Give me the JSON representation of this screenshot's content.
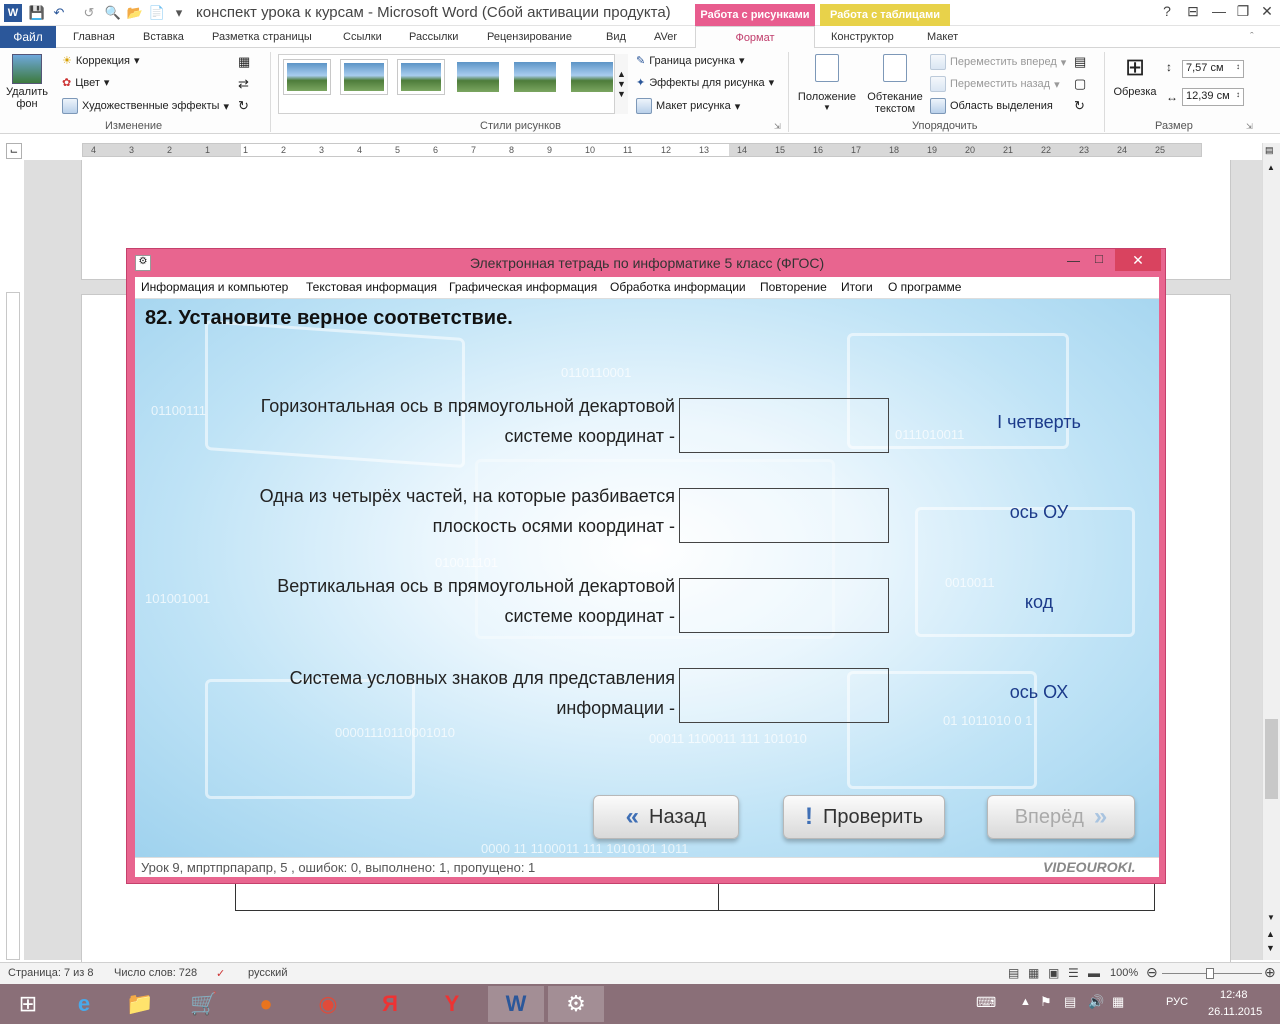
{
  "word": {
    "title": "конспект урока к курсам  -  Microsoft Word (Сбой активации продукта)",
    "context_tabs": [
      "Работа с рисунками",
      "Работа с таблицами"
    ],
    "tabs": [
      "Файл",
      "Главная",
      "Вставка",
      "Разметка страницы",
      "Ссылки",
      "Рассылки",
      "Рецензирование",
      "Вид",
      "AVer",
      "Формат",
      "Конструктор",
      "Макет"
    ],
    "ribbon": {
      "remove_bg": "Удалить фон",
      "correction": "Коррекция",
      "color": "Цвет",
      "artistic": "Художественные эффекты",
      "group_change": "Изменение",
      "group_styles": "Стили рисунков",
      "border": "Граница рисунка",
      "effects": "Эффекты для рисунка",
      "layout": "Макет рисунка",
      "position": "Положение",
      "wrap": "Обтекание текстом",
      "bring_forward": "Переместить вперед",
      "send_backward": "Переместить назад",
      "selection_pane": "Область выделения",
      "group_arrange": "Упорядочить",
      "crop": "Обрезка",
      "height": "7,57 см",
      "width": "12,39 см",
      "group_size": "Размер"
    },
    "ruler_marks": [
      "4",
      "3",
      "2",
      "1",
      "1",
      "2",
      "3",
      "4",
      "5",
      "6",
      "7",
      "8",
      "9",
      "10",
      "11",
      "12",
      "13",
      "14",
      "15",
      "16",
      "17",
      "18",
      "19",
      "20",
      "21",
      "22",
      "23",
      "24",
      "25"
    ],
    "status": {
      "page": "Страница: 7 из 8",
      "words": "Число слов: 728",
      "lang": "русский",
      "zoom": "100%"
    }
  },
  "app": {
    "title": "Электронная тетрадь по информатике 5 класс (ФГОС)",
    "menu": [
      "Информация и компьютер",
      "Текстовая информация",
      "Графическая информация",
      "Обработка информации",
      "Повторение",
      "Итоги",
      "О программе"
    ],
    "question": "82. Установите верное соответствие.",
    "items": [
      {
        "line1": "Горизонтальная ось в прямоугольной декартовой",
        "line2": "системе координат -",
        "answer": "I четверть"
      },
      {
        "line1": "Одна из четырёх частей, на которые разбивается",
        "line2": "плоскость осями координат -",
        "answer": "ось ОУ"
      },
      {
        "line1": "Вертикальная ось в прямоугольной декартовой",
        "line2": "системе координат -",
        "answer": "код"
      },
      {
        "line1": "Система условных знаков для представления",
        "line2": "информации -",
        "answer": "ось ОХ"
      }
    ],
    "buttons": {
      "back": "Назад",
      "check": "Проверить",
      "next": "Вперёд"
    },
    "status": "Урок 9, мпртпрпарапр, 5 , ошибок: 0, выполнено: 1, пропущено: 1",
    "brand": "VIDEOUROKI.",
    "bg_binary": [
      "0110110001",
      "01100111",
      "0111010011",
      "0010011",
      "101001001",
      "010011101",
      "00011 1100011 111 101010",
      "00001110110001010",
      "01 1011010 0 1",
      "0000 11 1100011 111 1010101 1011"
    ]
  },
  "taskbar": {
    "lang": "РУС",
    "time": "12:48",
    "date": "26.11.2015"
  },
  "colors": {
    "word_blue": "#2b579a",
    "app_frame": "#e8658f",
    "context_pink": "#e85c8e",
    "context_yellow": "#e8d24a"
  }
}
